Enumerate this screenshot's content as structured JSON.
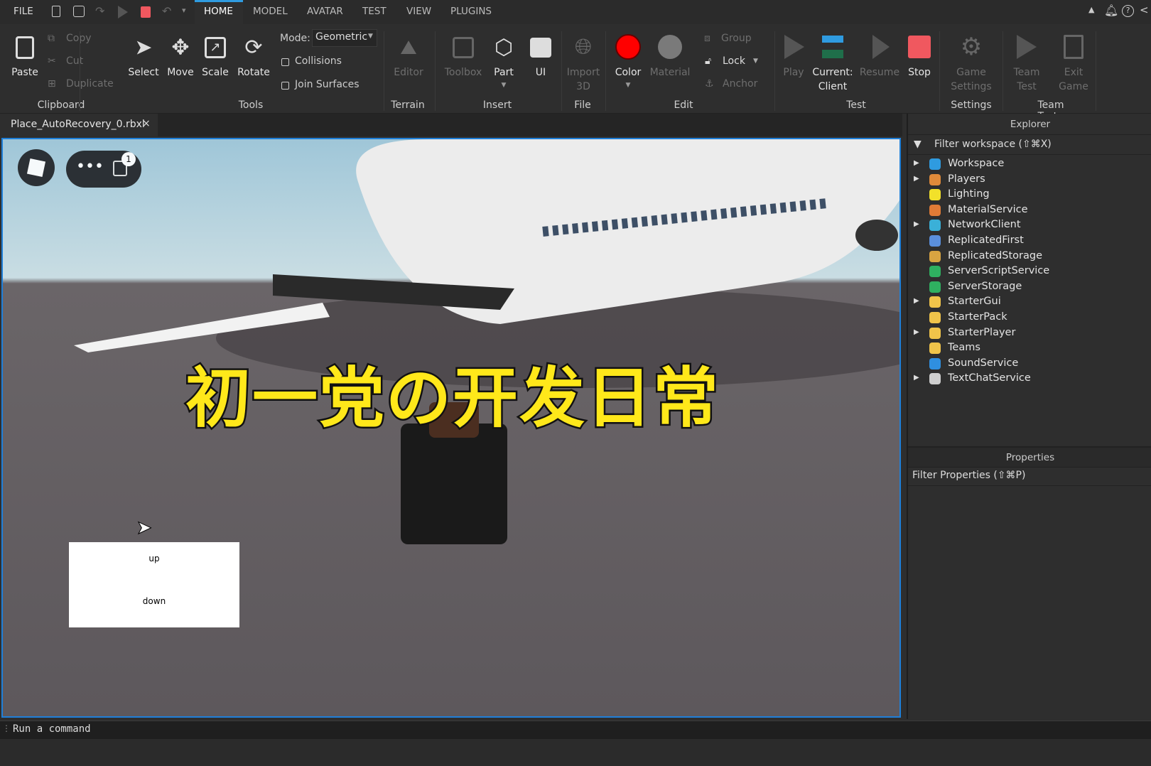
{
  "menubar": {
    "file": "FILE",
    "tabs": [
      "HOME",
      "MODEL",
      "AVATAR",
      "TEST",
      "VIEW",
      "PLUGINS"
    ],
    "active_tab": "HOME"
  },
  "ribbon": {
    "clipboard": {
      "paste": "Paste",
      "copy": "Copy",
      "cut": "Cut",
      "duplicate": "Duplicate",
      "group": "Clipboard"
    },
    "tools": {
      "select": "Select",
      "move": "Move",
      "scale": "Scale",
      "rotate": "Rotate",
      "mode_label": "Mode:",
      "mode_value": "Geometric",
      "collisions": "Collisions",
      "collisions_checked": false,
      "join_surfaces": "Join Surfaces",
      "join_checked": false,
      "group": "Tools"
    },
    "terrain": {
      "editor": "Editor",
      "group": "Terrain"
    },
    "insert": {
      "toolbox": "Toolbox",
      "part": "Part",
      "ui": "UI",
      "group": "Insert"
    },
    "file": {
      "import": "Import",
      "import2": "3D",
      "group": "File"
    },
    "edit": {
      "color": "Color",
      "material": "Material",
      "group_btn": "Group",
      "lock": "Lock",
      "anchor": "Anchor",
      "group": "Edit",
      "color_value": "#ff0000"
    },
    "test": {
      "play": "Play",
      "current": "Current:",
      "client": "Client",
      "resume": "Resume",
      "stop": "Stop",
      "group": "Test"
    },
    "settings": {
      "game": "Game",
      "settings": "Settings",
      "group": "Settings"
    },
    "team_test": {
      "team": "Team",
      "test": "Test",
      "exit": "Exit",
      "game": "Game",
      "group": "Team Test"
    }
  },
  "document_tab": {
    "name": "Place_AutoRecovery_0.rbxl",
    "close": "×"
  },
  "viewport": {
    "overlay_title": "初一党の开发日常",
    "notification_count": "1",
    "gui_buttons": [
      "up",
      "down"
    ]
  },
  "explorer": {
    "title": "Explorer",
    "filter": "Filter workspace (⇧⌘X)",
    "items": [
      {
        "name": "Workspace",
        "expandable": true,
        "color": "#2f9be0"
      },
      {
        "name": "Players",
        "expandable": true,
        "color": "#e08a3a"
      },
      {
        "name": "Lighting",
        "expandable": false,
        "color": "#f2e12a"
      },
      {
        "name": "MaterialService",
        "expandable": false,
        "color": "#e07b36"
      },
      {
        "name": "NetworkClient",
        "expandable": true,
        "color": "#3ab0d8"
      },
      {
        "name": "ReplicatedFirst",
        "expandable": false,
        "color": "#5a8fdc"
      },
      {
        "name": "ReplicatedStorage",
        "expandable": false,
        "color": "#d9a441"
      },
      {
        "name": "ServerScriptService",
        "expandable": false,
        "color": "#2fb060"
      },
      {
        "name": "ServerStorage",
        "expandable": false,
        "color": "#2fb060"
      },
      {
        "name": "StarterGui",
        "expandable": true,
        "color": "#f0c44a"
      },
      {
        "name": "StarterPack",
        "expandable": false,
        "color": "#f0c44a"
      },
      {
        "name": "StarterPlayer",
        "expandable": true,
        "color": "#f0c44a"
      },
      {
        "name": "Teams",
        "expandable": false,
        "color": "#f0c44a"
      },
      {
        "name": "SoundService",
        "expandable": false,
        "color": "#2f8fe0"
      },
      {
        "name": "TextChatService",
        "expandable": true,
        "color": "#cfcfcf"
      }
    ]
  },
  "properties": {
    "title": "Properties",
    "filter": "Filter Properties (⇧⌘P)"
  },
  "command_bar": {
    "placeholder": "Run a command"
  },
  "colors": {
    "accent": "#1f7fd8",
    "stop": "#f0585f",
    "title_yellow": "#ffe81a"
  }
}
